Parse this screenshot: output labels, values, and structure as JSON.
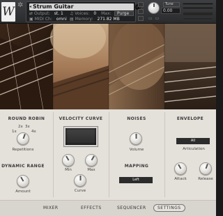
{
  "header": {
    "logo_text": "W",
    "instrument_name": "Strum Guitar",
    "output_label": "Output:",
    "output_value": "st. 1",
    "voices_label": "Voices:",
    "voices_value": "0",
    "max_label": "Max:",
    "max_value": "512",
    "purge_label": "Purge",
    "midi_label": "MIDI Ch:",
    "midi_value": "omni",
    "memory_label": "Memory:",
    "memory_value": "271.82 MB",
    "tune_label": "Tune",
    "tune_value": "0.00",
    "icons": [
      "gear-icon",
      "camera-icon",
      "info-icon",
      "aux-icon",
      "pv-icon"
    ]
  },
  "photo": {
    "colors": {
      "wood_dark": "#2a1a12",
      "wood_mid": "#6b4a34",
      "wood_light": "#b88c64",
      "fret": "#d8cfc2"
    }
  },
  "panel": {
    "round_robin": {
      "title": "ROUND ROBIN",
      "options": [
        "1x",
        "2x",
        "3x",
        "4x"
      ],
      "knob_label": "Repetitions"
    },
    "dynamic_range": {
      "title": "DYNAMIC RANGE",
      "knob_label": "Amount"
    },
    "velocity_curve": {
      "title": "VELOCITY CURVE",
      "min_label": "Min",
      "max_label": "Max",
      "curve_label": "Curve"
    },
    "noises": {
      "title": "NOISES",
      "knob_label": "Volume"
    },
    "mapping": {
      "title": "MAPPING",
      "value": "Left"
    },
    "envelope": {
      "title": "ENVELOPE",
      "articulation_value": "All",
      "articulation_label": "Articulation",
      "attack_label": "Attack",
      "release_label": "Release"
    }
  },
  "nav": {
    "tabs": [
      "MIXER",
      "EFFECTS",
      "SEQUENCER",
      "SETTINGS"
    ],
    "active": "SETTINGS"
  },
  "colors": {
    "panel_bg": "#e4e0da",
    "lcd_bg": "#2c2c2c",
    "header_bg": "#2f3033"
  }
}
